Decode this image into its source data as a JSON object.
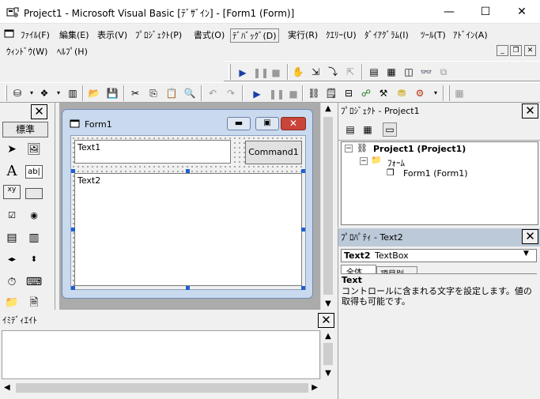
{
  "window": {
    "title": "Project1 - Microsoft Visual Basic [ﾃﾞｻﾞｲﾝ] - [Form1 (Form)]",
    "minimize": "—",
    "maximize": "☐",
    "close": "✕"
  },
  "menu": [
    {
      "label": "ﾌｧｲﾙ(F)"
    },
    {
      "label": "編集(E)"
    },
    {
      "label": "表示(V)"
    },
    {
      "label": "ﾌﾟﾛｼﾞｪｸﾄ(P)"
    },
    {
      "label": "書式(O)"
    },
    {
      "label": "ﾃﾞﾊﾞｯｸﾞ(D)"
    },
    {
      "label": "実行(R)"
    },
    {
      "label": "ｸｴﾘｰ(U)"
    },
    {
      "label": "ﾀﾞｲｱｸﾞﾗﾑ(I)"
    },
    {
      "label": "ﾂｰﾙ(T)"
    },
    {
      "label": "ｱﾄﾞｲﾝ(A)"
    },
    {
      "label": "ｳｨﾝﾄﾞｳ(W)"
    },
    {
      "label": "ﾍﾙﾌﾟ(H)"
    }
  ],
  "toolbox": {
    "tab": "標準"
  },
  "form": {
    "caption": "Form1",
    "text1": "Text1",
    "text2": "Text2",
    "command1": "Command1"
  },
  "project": {
    "title": "ﾌﾟﾛｼﾞｪｸﾄ - Project1",
    "root": "Project1 (Project1)",
    "folder": "ﾌｫｰﾑ",
    "item": "Form1 (Form1)"
  },
  "properties": {
    "title": "ﾌﾟﾛﾊﾟﾃｨ - Text2",
    "object_name": "Text2",
    "object_type": "TextBox",
    "tab_all": "全体",
    "tab_category": "項目別",
    "desc_title": "Text",
    "desc_text": "コントロールに含まれる文字を設定します。値の取得も可能です。"
  },
  "immediate": {
    "title": "ｲﾐﾃﾞｨｴｲﾄ"
  }
}
